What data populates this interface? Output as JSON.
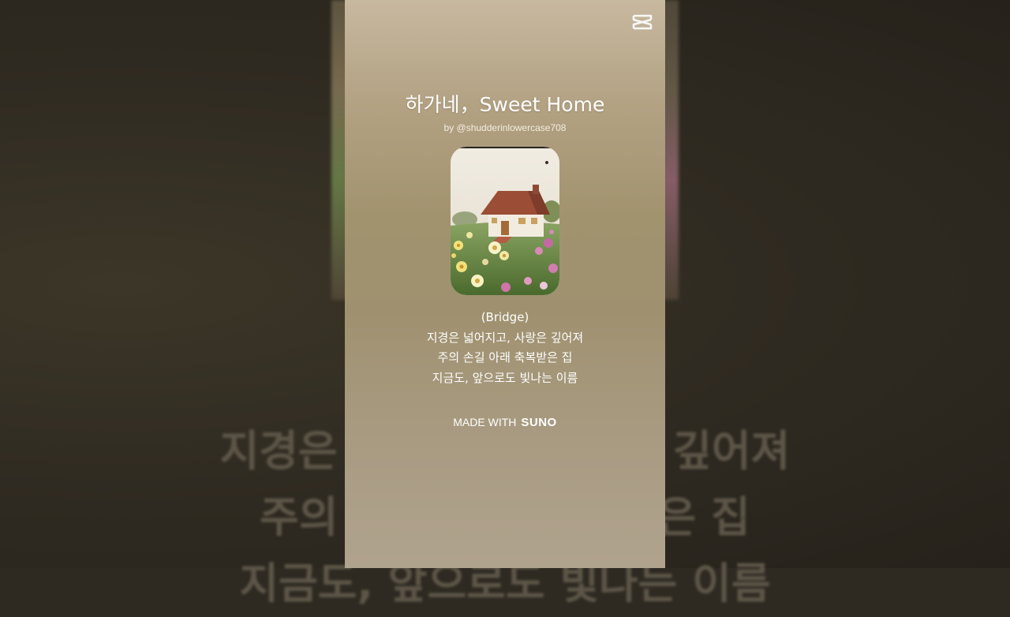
{
  "song": {
    "title": "하가네，Sweet Home",
    "artist": "by @shudderinlowercase708"
  },
  "lyrics": {
    "section": "(Bridge)",
    "line1": "지경은 넓어지고, 사랑은 깊어져",
    "line2": "주의 손길 아래 축복받은 집",
    "line3": "지금도, 앞으로도 빛나는 이름"
  },
  "footer": {
    "made_with": "MADE WITH",
    "brand": "SUNO"
  },
  "background_lyrics": {
    "line1": "지경은 넓어지고, 사랑은 깊어져",
    "line2": "주의 손길 아래 축복받은 집",
    "line3": "지금도, 앞으로도 빛나는 이름"
  },
  "icons": {
    "capcut": "capcut-logo-icon"
  },
  "colors": {
    "panel_top": "#c7b8a0",
    "panel_mid": "#a2936f",
    "text": "#ffffff",
    "backdrop": "#2e2a22"
  }
}
